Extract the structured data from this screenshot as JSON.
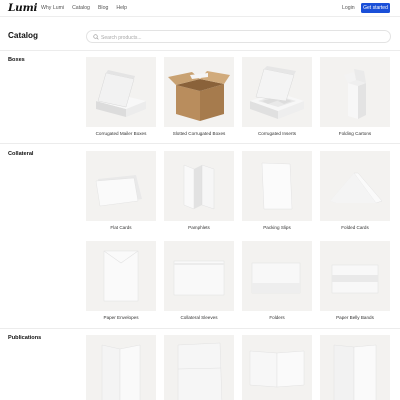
{
  "nav": {
    "logo": "Lumi",
    "links": [
      "Why Lumi",
      "Catalog",
      "Blog",
      "Help"
    ],
    "login": "Login",
    "cta": "Get started"
  },
  "catalog": {
    "title": "Catalog",
    "search_placeholder": "Search products..."
  },
  "sections": [
    {
      "title": "Boxes",
      "items": [
        {
          "label": "Corrugated Mailer Boxes",
          "icon": "mailer-box"
        },
        {
          "label": "Slotted Corrugated Boxes",
          "icon": "slotted-box"
        },
        {
          "label": "Corrugated Inserts",
          "icon": "insert-box"
        },
        {
          "label": "Folding Cartons",
          "icon": "folding-carton"
        }
      ]
    },
    {
      "title": "Collateral",
      "items": [
        {
          "label": "Flat Cards",
          "icon": "flat-cards"
        },
        {
          "label": "Pamphlets",
          "icon": "pamphlet"
        },
        {
          "label": "Packing Slips",
          "icon": "packing-slip"
        },
        {
          "label": "Folded Cards",
          "icon": "folded-card"
        },
        {
          "label": "Paper Envelopes",
          "icon": "envelope"
        },
        {
          "label": "Collateral Sleeves",
          "icon": "sleeve"
        },
        {
          "label": "Folders",
          "icon": "folder"
        },
        {
          "label": "Paper Belly Bands",
          "icon": "belly-band"
        }
      ]
    },
    {
      "title": "Publications",
      "items": [
        {
          "label": "",
          "icon": "book"
        },
        {
          "label": "",
          "icon": "grid-notebook"
        },
        {
          "label": "",
          "icon": "open-notebook"
        },
        {
          "label": "",
          "icon": "stacked-book"
        }
      ]
    }
  ],
  "colors": {
    "accent": "#1a4fd8",
    "thumb_bg": "#f3f2f0",
    "kraft": "#b98d5d"
  }
}
